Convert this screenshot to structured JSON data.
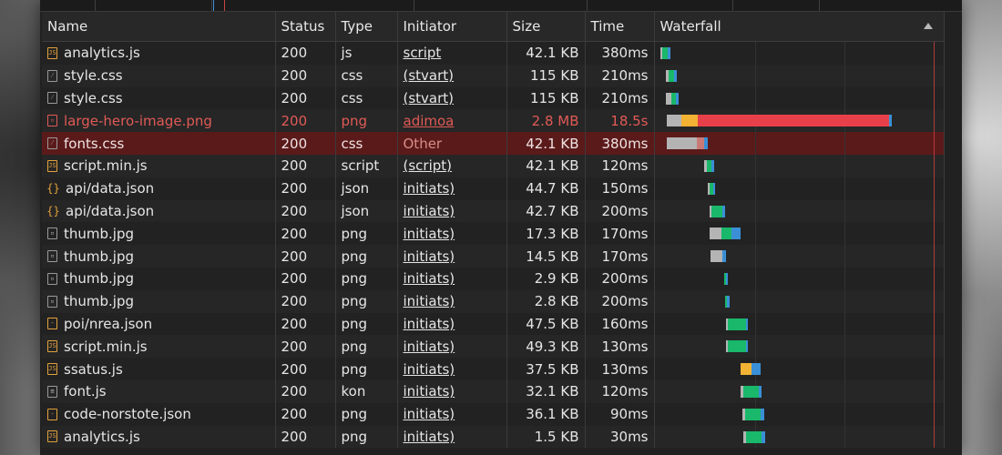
{
  "colors": {
    "panel_bg": "#212121",
    "error_text": "#e05a56",
    "selected_row": "#5b1a1a",
    "wf_queue": "#b4b4b4",
    "wf_wait": "#f2b233",
    "wf_download": "#19b86a",
    "wf_tail": "#3a8fd6",
    "wf_error": "#e8404a",
    "wf_selected": "#c97a76"
  },
  "columns": {
    "name": "Name",
    "status": "Status",
    "type": "Type",
    "initiator": "Initiator",
    "size": "Size",
    "time": "Time",
    "waterfall": "Waterfall"
  },
  "rows": [
    {
      "name": "analytics.js",
      "icon": "js-file-icon",
      "glyph": "JS",
      "status": "200",
      "type": "js",
      "initiator": "script",
      "initiator_link": true,
      "size": "42.1 KB",
      "time": "380ms"
    },
    {
      "name": "style.css",
      "icon": "css-file-icon",
      "glyph": "⁄",
      "status": "200",
      "type": "css",
      "initiator": "(stvart)",
      "initiator_link": true,
      "size": "115 KB",
      "time": "210ms"
    },
    {
      "name": "style.css",
      "icon": "css-file-icon",
      "glyph": "⁄",
      "status": "200",
      "type": "css",
      "initiator": "(stvart)",
      "initiator_link": true,
      "size": "115 KB",
      "time": "210ms"
    },
    {
      "name": "large-hero-image.png",
      "icon": "image-file-icon",
      "glyph": "▫",
      "status": "200",
      "type": "png",
      "initiator": "adimoa",
      "initiator_link": true,
      "size": "2.8 MB",
      "time": "18.5s",
      "state": "error"
    },
    {
      "name": "fonts.css",
      "icon": "css-file-icon",
      "glyph": "⁄",
      "status": "200",
      "type": "css",
      "initiator": "Other",
      "initiator_link": false,
      "size": "42.1 KB",
      "time": "380ms",
      "state": "selected"
    },
    {
      "name": "script.min.js",
      "icon": "js-file-icon",
      "glyph": "JS",
      "status": "200",
      "type": "script",
      "initiator": "(script)",
      "initiator_link": true,
      "size": "42.1 KB",
      "time": "120ms"
    },
    {
      "name": "api/data.json",
      "icon": "json-file-icon",
      "glyph": "{}",
      "status": "200",
      "type": "json",
      "initiator": "initiats)",
      "initiator_link": true,
      "size": "44.7 KB",
      "time": "150ms"
    },
    {
      "name": "api/data.json",
      "icon": "json-file-icon",
      "glyph": "{}",
      "status": "200",
      "type": "json",
      "initiator": "initiats)",
      "initiator_link": true,
      "size": "42.7 KB",
      "time": "200ms"
    },
    {
      "name": "thumb.jpg",
      "icon": "image-file-icon",
      "glyph": "▫",
      "status": "200",
      "type": "png",
      "initiator": "initiats)",
      "initiator_link": true,
      "size": "17.3 KB",
      "time": "170ms"
    },
    {
      "name": "thumb.jpg",
      "icon": "image-file-icon",
      "glyph": "▫",
      "status": "200",
      "type": "png",
      "initiator": "initiats)",
      "initiator_link": true,
      "size": "14.5 KB",
      "time": "170ms"
    },
    {
      "name": "thumb.jpg",
      "icon": "image-file-icon",
      "glyph": "▫",
      "status": "200",
      "type": "png",
      "initiator": "initiats)",
      "initiator_link": true,
      "size": "2.9 KB",
      "time": "200ms"
    },
    {
      "name": "thumb.jpg",
      "icon": "image-file-icon",
      "glyph": "▫",
      "status": "200",
      "type": "png",
      "initiator": "initiats)",
      "initiator_link": true,
      "size": "2.8 KB",
      "time": "200ms"
    },
    {
      "name": "poi/nrea.json",
      "icon": "json-file-icon",
      "glyph": "-",
      "status": "200",
      "type": "png",
      "initiator": "initiats)",
      "initiator_link": true,
      "size": "47.5 KB",
      "time": "160ms"
    },
    {
      "name": "script.min.js",
      "icon": "js-file-icon",
      "glyph": "JS",
      "status": "200",
      "type": "png",
      "initiator": "initiats)",
      "initiator_link": true,
      "size": "49.3 KB",
      "time": "130ms"
    },
    {
      "name": "ssatus.js",
      "icon": "js-file-icon",
      "glyph": "JS",
      "status": "200",
      "type": "png",
      "initiator": "initiats)",
      "initiator_link": true,
      "size": "37.5 KB",
      "time": "130ms"
    },
    {
      "name": "font.js",
      "icon": "generic-file-icon",
      "glyph": "≡",
      "status": "200",
      "type": "kon",
      "initiator": "initiats)",
      "initiator_link": true,
      "size": "32.1 KB",
      "time": "120ms"
    },
    {
      "name": "code-norstote.json",
      "icon": "json-file-icon",
      "glyph": "-",
      "status": "200",
      "type": "png",
      "initiator": "initiats)",
      "initiator_link": true,
      "size": "36.1 KB",
      "time": "90ms"
    },
    {
      "name": "analytics.js",
      "icon": "js-file-icon",
      "glyph": "JS",
      "status": "200",
      "type": "png",
      "initiator": "initiats)",
      "initiator_link": true,
      "size": "1.5 KB",
      "time": "30ms"
    }
  ]
}
